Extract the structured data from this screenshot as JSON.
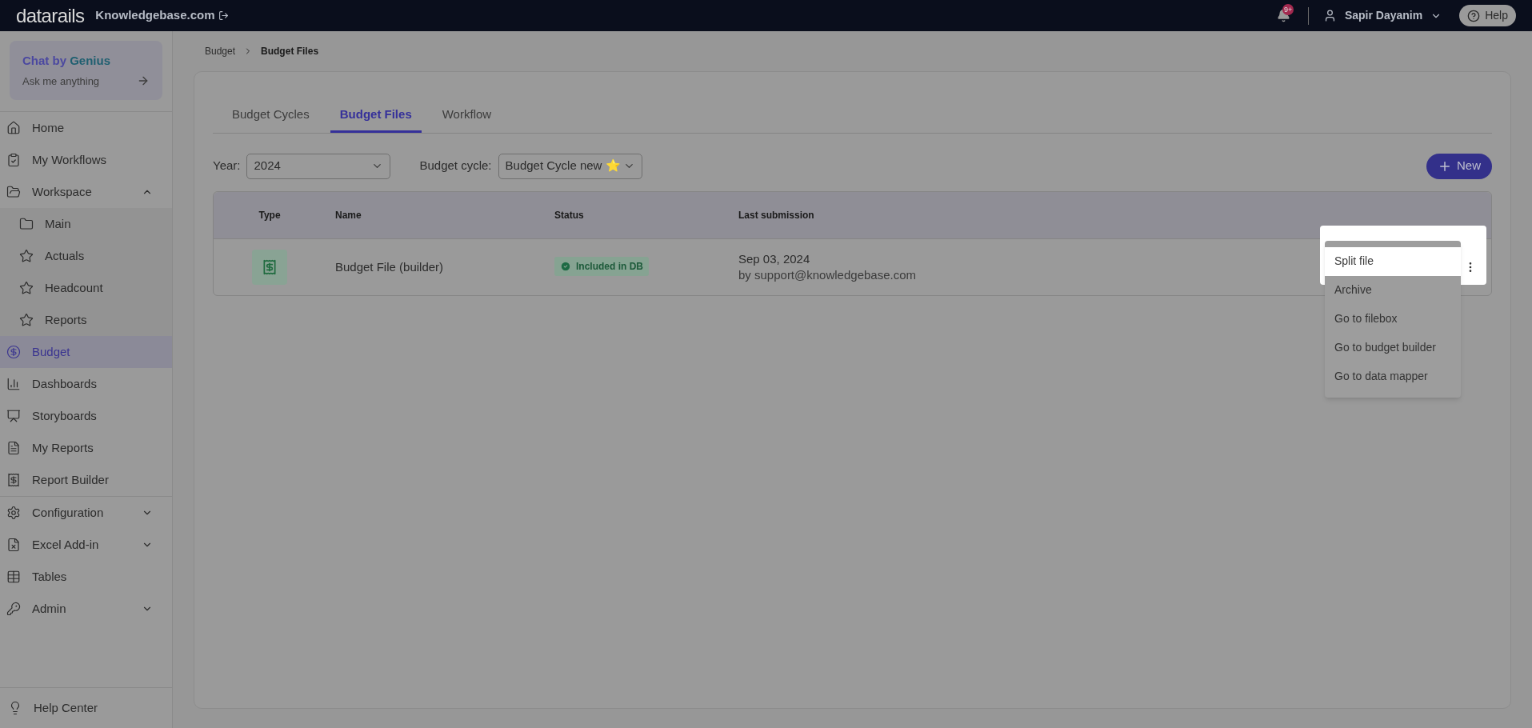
{
  "topbar": {
    "brand": "datarails",
    "company": "Knowledgebase.com",
    "notification_count": "9+",
    "user": "Sapir Dayanim",
    "help": "Help"
  },
  "sidebar": {
    "chat": {
      "title": "Chat by",
      "title_accent": "Genius",
      "subtitle": "Ask me anything"
    },
    "nav_groups": [
      [
        {
          "label": "Home",
          "selected": false
        },
        {
          "label": "My Workflows",
          "selected": false
        },
        {
          "label": "Workspace",
          "selected": false,
          "expanded": true,
          "children": [
            {
              "label": "Main",
              "selected": false
            },
            {
              "label": "Actuals",
              "selected": false
            },
            {
              "label": "Headcount",
              "selected": false
            },
            {
              "label": "Reports",
              "selected": false
            }
          ]
        },
        {
          "label": "Budget",
          "selected": true
        },
        {
          "label": "Dashboards",
          "selected": false
        },
        {
          "label": "Storyboards",
          "selected": false
        },
        {
          "label": "My Reports",
          "selected": false
        },
        {
          "label": "Report Builder",
          "selected": false
        }
      ],
      [
        {
          "label": "Configuration",
          "selected": false,
          "expanded": false
        },
        {
          "label": "Excel Add-in",
          "selected": false,
          "expanded": false
        },
        {
          "label": "Tables",
          "selected": false
        },
        {
          "label": "Admin",
          "selected": false,
          "expanded": false
        }
      ]
    ],
    "footer": "Help Center"
  },
  "breadcrumb": [
    "Budget",
    "Budget Files"
  ],
  "tabs": [
    {
      "label": "Budget Cycles",
      "selected": false
    },
    {
      "label": "Budget Files",
      "selected": true
    },
    {
      "label": "Workflow",
      "selected": false
    }
  ],
  "filters": [
    {
      "label": "Year:",
      "value": "2024"
    },
    {
      "label": "Budget cycle:",
      "value": "Budget Cycle new ⭐"
    }
  ],
  "new_button": "New",
  "table": {
    "columns": [
      "Type",
      "Name",
      "Status",
      "Last submission"
    ],
    "rows": [
      {
        "name": "Budget File (builder)",
        "status": "Included in DB",
        "date": "Sep 03, 2024",
        "by": "by support@knowledgebase.com"
      }
    ]
  },
  "row_menu": [
    {
      "label": "Split file",
      "highlighted": true
    },
    {
      "label": "Archive",
      "highlighted": false
    },
    {
      "label": "Go to filebox",
      "highlighted": false
    },
    {
      "label": "Go to budget builder",
      "highlighted": false
    },
    {
      "label": "Go to data mapper",
      "highlighted": false
    }
  ]
}
